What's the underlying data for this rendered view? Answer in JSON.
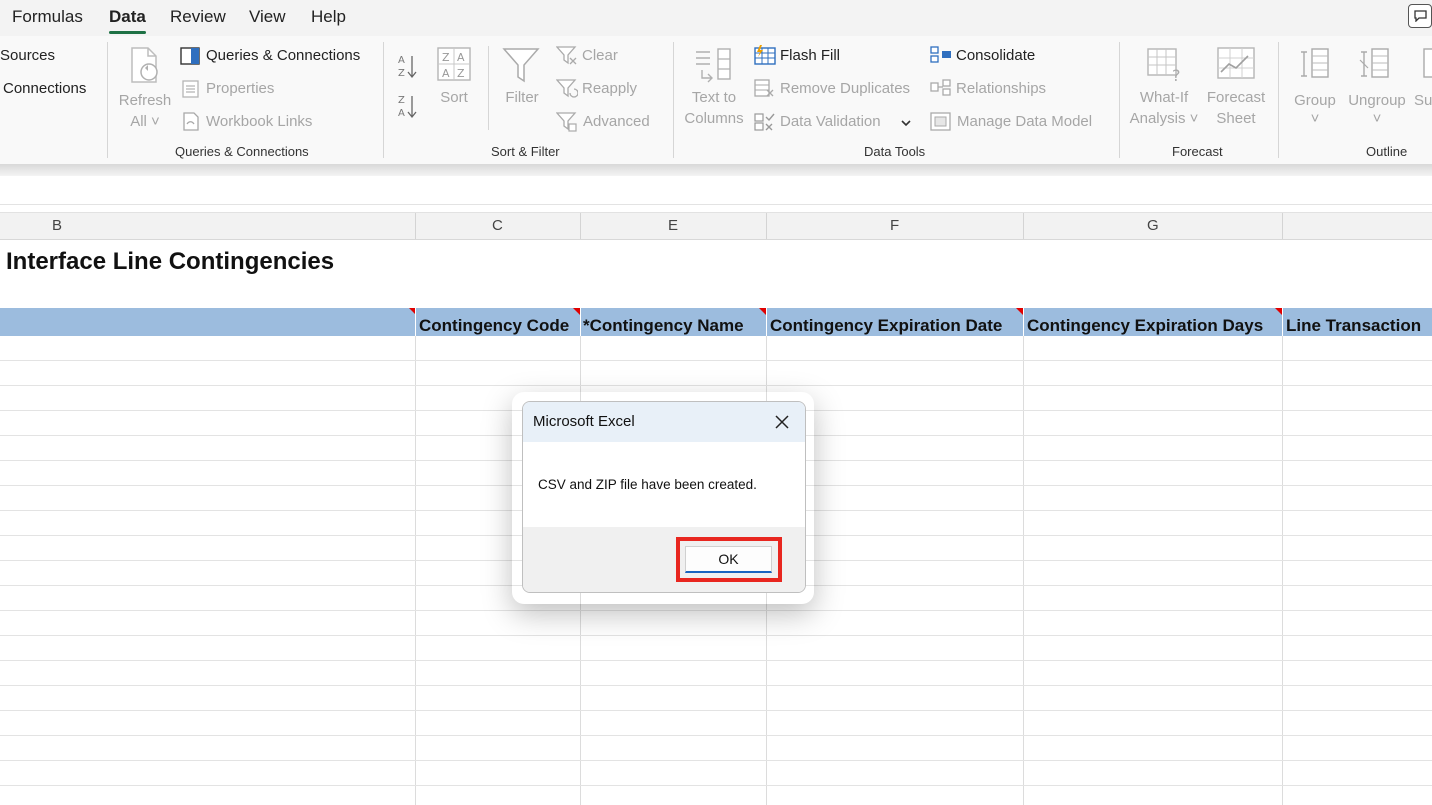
{
  "menu": {
    "items": [
      "Formulas",
      "Data",
      "Review",
      "View",
      "Help"
    ],
    "active": "Data"
  },
  "ribbon": {
    "get_data": {
      "sources": "Sources",
      "connections": "Connections"
    },
    "queries": {
      "refresh_line1": "Refresh",
      "refresh_line2": "All ˅",
      "queries_connections": "Queries & Connections",
      "properties": "Properties",
      "workbook_links": "Workbook Links",
      "group_label": "Queries & Connections"
    },
    "sort_filter": {
      "sort": "Sort",
      "filter": "Filter",
      "clear": "Clear",
      "reapply": "Reapply",
      "advanced": "Advanced",
      "group_label": "Sort & Filter"
    },
    "data_tools": {
      "text_to_line1": "Text to",
      "text_to_line2": "Columns",
      "flash_fill": "Flash Fill",
      "remove_duplicates": "Remove Duplicates",
      "data_validation": "Data Validation",
      "consolidate": "Consolidate",
      "relationships": "Relationships",
      "manage_data_model": "Manage Data Model",
      "group_label": "Data Tools"
    },
    "forecast": {
      "whatif_line1": "What-If",
      "whatif_line2": "Analysis ˅",
      "forecast_line1": "Forecast",
      "forecast_line2": "Sheet",
      "group_label": "Forecast"
    },
    "outline": {
      "group": "Group",
      "ungroup": "Ungroup",
      "subtotal": "Sul",
      "group_label": "Outline"
    }
  },
  "columns": {
    "b": "B",
    "c": "C",
    "e": "E",
    "f": "F",
    "g": "G"
  },
  "sheet": {
    "title": "Interface Line Contingencies",
    "headers": [
      "Contingency Code",
      "*Contingency Name",
      "Contingency Expiration Date",
      "Contingency Expiration Days",
      "Line Transaction"
    ]
  },
  "dialog": {
    "title": "Microsoft Excel",
    "message": "CSV and ZIP file have been created.",
    "ok_label": "OK"
  },
  "colors": {
    "accent_green": "#1e7145",
    "header_fill": "#9cbcde",
    "highlight_red": "#e8261f"
  }
}
